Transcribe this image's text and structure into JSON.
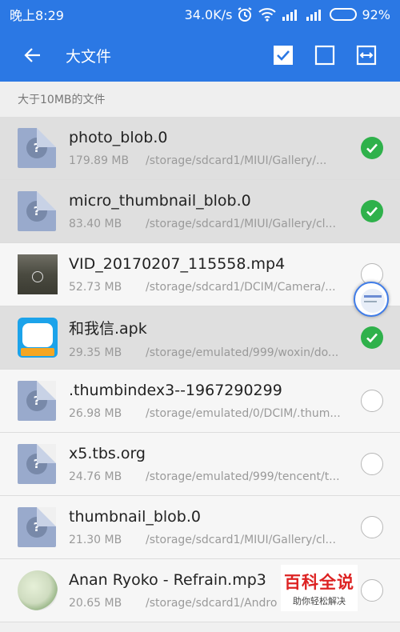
{
  "status_bar": {
    "time": "晚上8:29",
    "speed": "34.0K/s",
    "battery": "92%",
    "battery_level": 0.92
  },
  "toolbar": {
    "title": "大文件"
  },
  "section_header": "大于10MB的文件",
  "files": [
    {
      "name": "photo_blob.0",
      "size": "179.89 MB",
      "path": "/storage/sdcard1/MIUI/Gallery/...",
      "thumb": "unknown-file-icon",
      "selected": true
    },
    {
      "name": "micro_thumbnail_blob.0",
      "size": "83.40 MB",
      "path": "/storage/sdcard1/MIUI/Gallery/cl...",
      "thumb": "unknown-file-icon",
      "selected": true
    },
    {
      "name": "VID_20170207_115558.mp4",
      "size": "52.73 MB",
      "path": "/storage/sdcard1/DCIM/Camera/...",
      "thumb": "video-thumbnail",
      "selected": false
    },
    {
      "name": "和我信.apk",
      "size": "29.35 MB",
      "path": "/storage/emulated/999/woxin/do...",
      "thumb": "apk-app-icon",
      "selected": true
    },
    {
      "name": ".thumbindex3--1967290299",
      "size": "26.98 MB",
      "path": "/storage/emulated/0/DCIM/.thum...",
      "thumb": "unknown-file-icon",
      "selected": false
    },
    {
      "name": "x5.tbs.org",
      "size": "24.76 MB",
      "path": "/storage/emulated/999/tencent/t...",
      "thumb": "unknown-file-icon",
      "selected": false
    },
    {
      "name": "thumbnail_blob.0",
      "size": "21.30 MB",
      "path": "/storage/sdcard1/MIUI/Gallery/cl...",
      "thumb": "unknown-file-icon",
      "selected": false
    },
    {
      "name": "Anan Ryoko - Refrain.mp3",
      "size": "20.65 MB",
      "path": "/storage/sdcard1/Andro",
      "thumb": "music-album-art",
      "selected": false
    }
  ],
  "watermark": {
    "title": "百科全说",
    "subtitle": "助你轻松解决"
  },
  "colors": {
    "primary": "#2b78e4",
    "check_green": "#2fb14b",
    "selected_row": "#dfdfdf"
  }
}
